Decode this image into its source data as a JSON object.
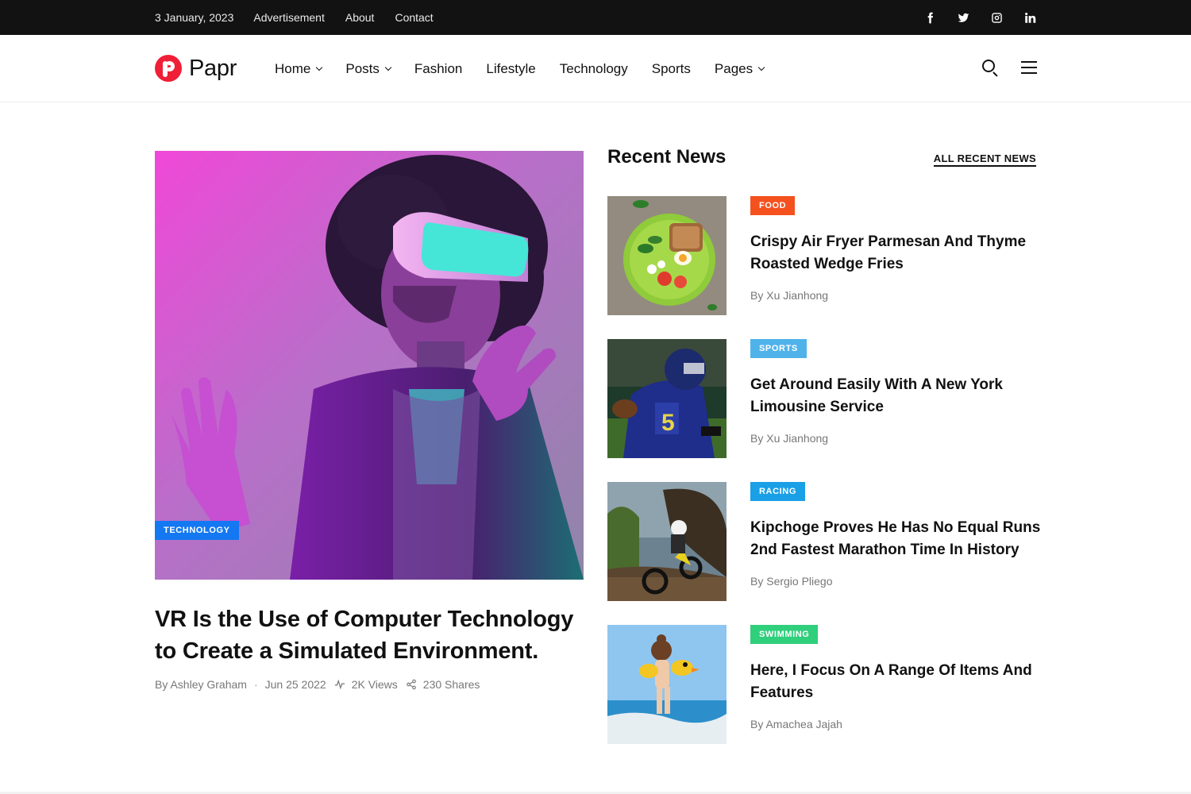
{
  "topbar": {
    "date": "3 January, 2023",
    "links": [
      "Advertisement",
      "About",
      "Contact"
    ],
    "socials": [
      "facebook-icon",
      "twitter-icon",
      "instagram-icon",
      "linkedin-icon"
    ]
  },
  "header": {
    "logo_text": "Papr",
    "nav": [
      {
        "label": "Home",
        "dropdown": true
      },
      {
        "label": "Posts",
        "dropdown": true
      },
      {
        "label": "Fashion",
        "dropdown": false
      },
      {
        "label": "Lifestyle",
        "dropdown": false
      },
      {
        "label": "Technology",
        "dropdown": false
      },
      {
        "label": "Sports",
        "dropdown": false
      },
      {
        "label": "Pages",
        "dropdown": true
      }
    ]
  },
  "featured": {
    "category": "TECHNOLOGY",
    "category_color": "#1378f2",
    "title": "VR Is the Use of Computer Technology to Create a Simulated Environment.",
    "author": "By Ashley Graham",
    "date": "Jun 25 2022",
    "views": "2K Views",
    "shares": "230 Shares"
  },
  "recent": {
    "title": "Recent News",
    "all_link": "ALL RECENT NEWS",
    "items": [
      {
        "category": "FOOD",
        "color": "#f4511e",
        "title": "Crispy Air Fryer Parmesan And Thyme Roasted Wedge Fries",
        "author": "By Xu Jianhong"
      },
      {
        "category": "SPORTS",
        "color": "#4fb3ea",
        "title": "Get Around Easily With A New York Limousine Service",
        "author": "By Xu Jianhong"
      },
      {
        "category": "RACING",
        "color": "#1aa0e6",
        "title": "Kipchoge Proves He Has No Equal Runs 2nd Fastest Marathon Time In History",
        "author": "By Sergio Pliego"
      },
      {
        "category": "SWIMMING",
        "color": "#2fcf7c",
        "title": "Here, I Focus On A Range Of Items And Features",
        "author": "By Amachea Jajah"
      }
    ]
  }
}
